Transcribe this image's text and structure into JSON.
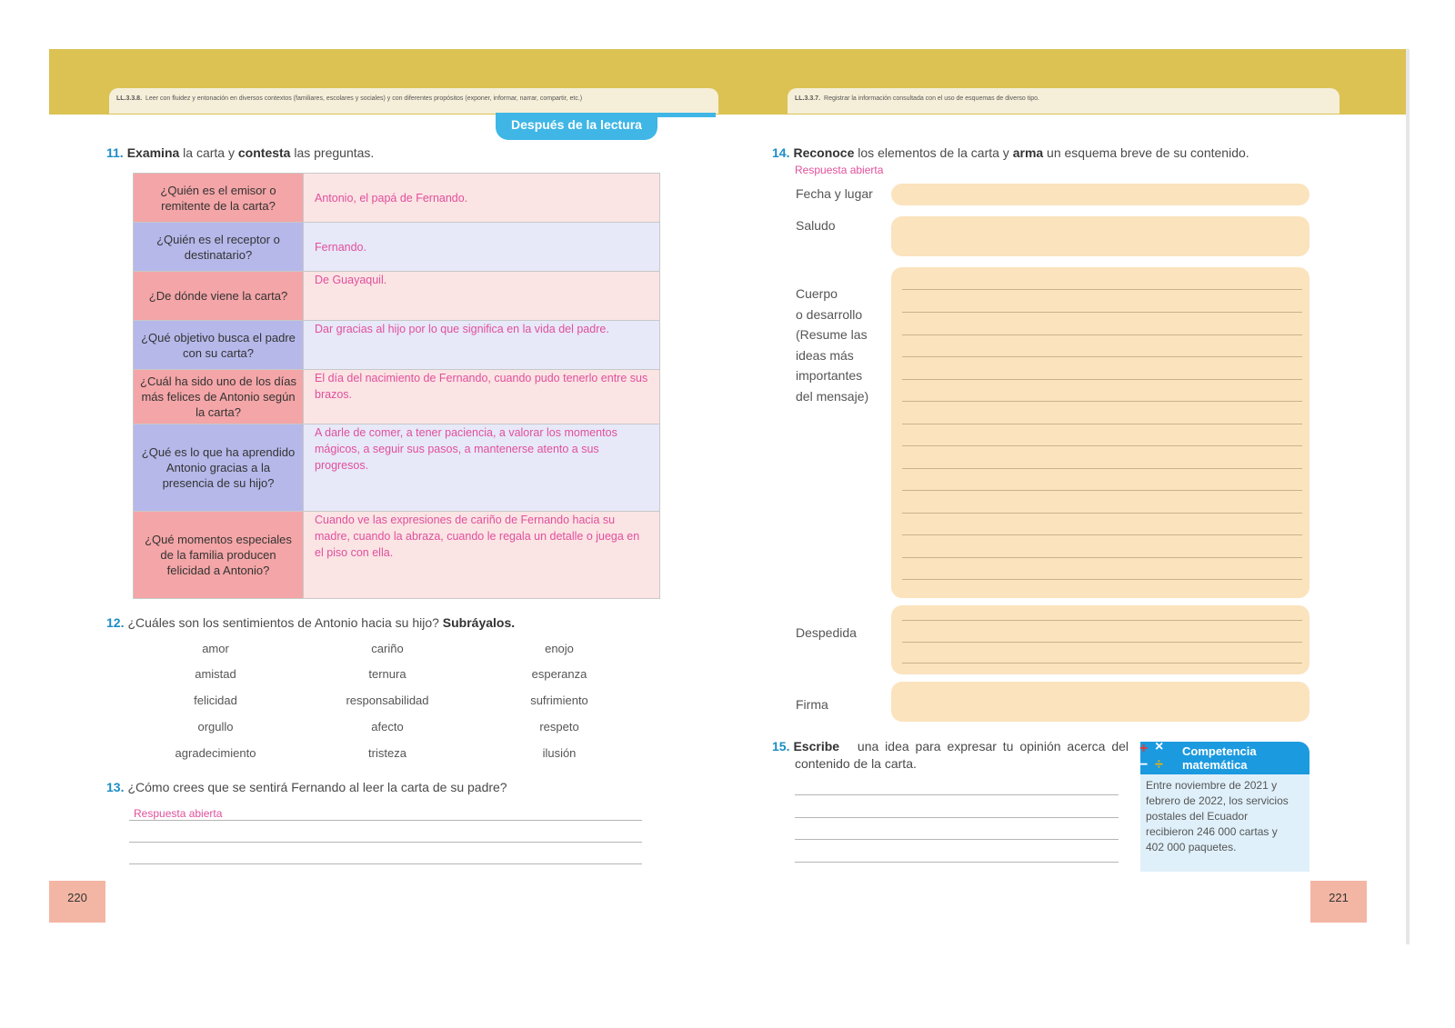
{
  "left_page": {
    "skill_code": "LL.3.3.8.",
    "skill_text": "Leer con fluidez y entonación en diversos contextos (familiares, escolares y sociales) y con diferentes propósitos (exponer, informar, narrar, compartir, etc.)",
    "section_tab": "Después de la lectura",
    "q11": {
      "num": "11.",
      "verb1": "Examina",
      "mid": " la carta y ",
      "verb2": "contesta",
      "end": " las preguntas."
    },
    "table": [
      {
        "q": "¿Quién es el emisor o remitente de la carta?",
        "a": "Antonio, el papá de Fernando."
      },
      {
        "q": "¿Quién es el receptor o destinatario?",
        "a": "Fernando."
      },
      {
        "q": "¿De dónde viene la carta?",
        "a": "De Guayaquil."
      },
      {
        "q": "¿Qué objetivo busca el padre con su carta?",
        "a": "Dar gracias al hijo por lo que significa en la vida del padre."
      },
      {
        "q": "¿Cuál ha sido uno de los días más felices de Antonio según la carta?",
        "a": "El día del nacimiento de Fernando, cuando pudo tenerlo entre sus brazos."
      },
      {
        "q": "¿Qué es lo que ha aprendido Antonio gracias a la presencia de su hijo?",
        "a": "A darle de comer, a tener paciencia, a valorar los momentos mágicos, a seguir sus pasos, a mantenerse atento a sus progresos."
      },
      {
        "q": "¿Qué momentos especiales de la familia producen felicidad a Antonio?",
        "a": "Cuando ve las expresiones de cariño de Fernando hacia su madre, cuando la abraza, cuando le regala un detalle o juega en el piso con ella."
      }
    ],
    "q12": {
      "num": "12.",
      "text": "¿Cuáles son los sentimientos de Antonio hacia su hijo? ",
      "bold": "Subráyalos."
    },
    "feelings": [
      [
        "amor",
        "cariño",
        "enojo"
      ],
      [
        "amistad",
        "ternura",
        "esperanza"
      ],
      [
        "felicidad",
        "responsabilidad",
        "sufrimiento"
      ],
      [
        "orgullo",
        "afecto",
        "respeto"
      ],
      [
        "agradecimiento",
        "tristeza",
        "ilusión"
      ]
    ],
    "q13": {
      "num": "13.",
      "text": "¿Cómo crees que se sentirá Fernando al leer la carta de su padre?"
    },
    "q13_answer": "Respuesta abierta",
    "page_number": "220"
  },
  "right_page": {
    "skill_code": "LL.3.3.7.",
    "skill_text": "Registrar la información consultada con el uso de esquemas de diverso tipo.",
    "q14": {
      "num": "14.",
      "verb1": "Reconoce",
      "mid": " los elementos de la carta y ",
      "verb2": "arma",
      "end": " un esquema breve de su contenido."
    },
    "q14_answer": "Respuesta abierta",
    "scheme": {
      "fecha": "Fecha y lugar",
      "saludo": "Saludo",
      "cuerpo": [
        "Cuerpo",
        "o desarrollo",
        "(Resume las",
        "ideas más",
        "importantes",
        "del mensaje)"
      ],
      "despedida": "Despedida",
      "firma": "Firma"
    },
    "q15": {
      "num": "15.",
      "verb": "Escribe",
      "line1": " una idea para expresar tu opinión acerca del",
      "line2": "contenido de la carta."
    },
    "competencia": {
      "title_line1": "Competencia",
      "title_line2": "matemática",
      "body": [
        "Entre noviembre de 2021 y",
        "febrero de 2022, los servicios",
        "postales del Ecuador",
        "recibieron 246 000 cartas y",
        "402 000 paquetes."
      ]
    },
    "page_number": "221"
  },
  "colors": {
    "band": "#dbc253",
    "tab_blue": "#3fb6e6",
    "answer_pink": "#e0509c",
    "row_pink": "#f4a5a7",
    "row_blue": "#b6b8ea",
    "scheme_box": "#fbe3bd",
    "number_blue": "#1b8dc6"
  }
}
